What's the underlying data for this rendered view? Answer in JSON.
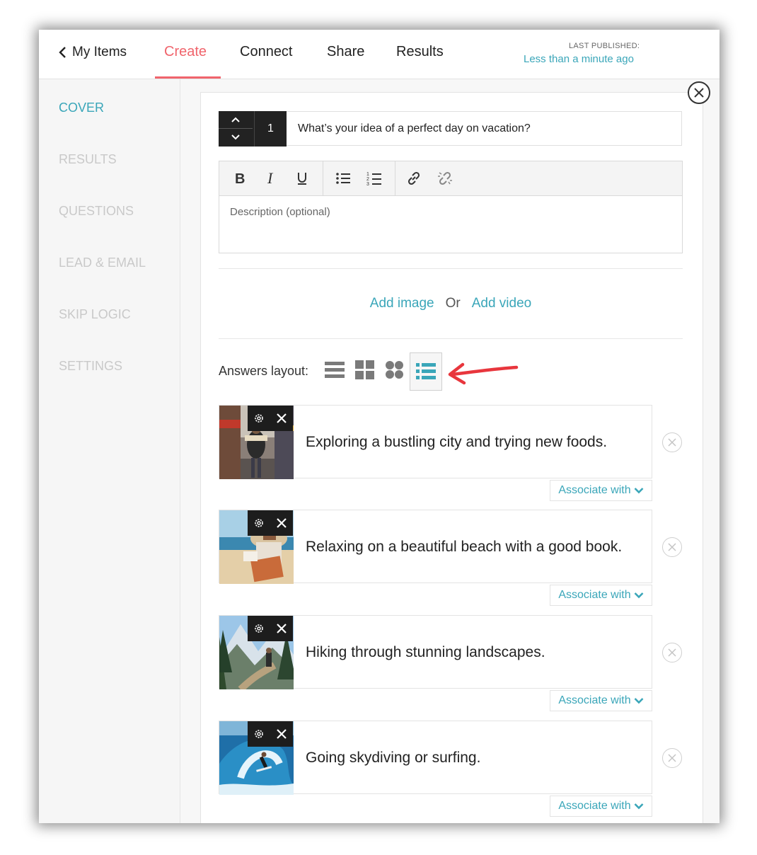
{
  "nav": {
    "back_label": "My Items",
    "tabs": [
      "Create",
      "Connect",
      "Share",
      "Results"
    ],
    "active_tab": "Create",
    "published_label": "LAST PUBLISHED:",
    "published_time": "Less than a minute ago"
  },
  "sidebar": {
    "items": [
      "COVER",
      "RESULTS",
      "QUESTIONS",
      "LEAD & EMAIL",
      "SKIP LOGIC",
      "SETTINGS"
    ],
    "active": "COVER"
  },
  "question": {
    "number": "1",
    "title": "What’s your idea of a perfect day on vacation?",
    "description_placeholder": "Description (optional)"
  },
  "media": {
    "add_image": "Add image",
    "or": "Or",
    "add_video": "Add video"
  },
  "layout": {
    "label": "Answers layout:",
    "options": [
      "rows-icon",
      "grid-icon",
      "circles-icon",
      "list-with-bullets-icon"
    ],
    "selected": "list-with-bullets-icon"
  },
  "answers": [
    {
      "text": "Exploring a bustling city and trying new foods.",
      "associate": "Associate with"
    },
    {
      "text": "Relaxing on a beautiful beach with a good book.",
      "associate": "Associate with"
    },
    {
      "text": "Hiking through stunning landscapes.",
      "associate": "Associate with"
    },
    {
      "text": "Going skydiving or surfing.",
      "associate": "Associate with"
    }
  ],
  "colors": {
    "accent": "#3aa6b9",
    "active_tab": "#f0646c",
    "annotation_arrow": "#e8363d"
  }
}
